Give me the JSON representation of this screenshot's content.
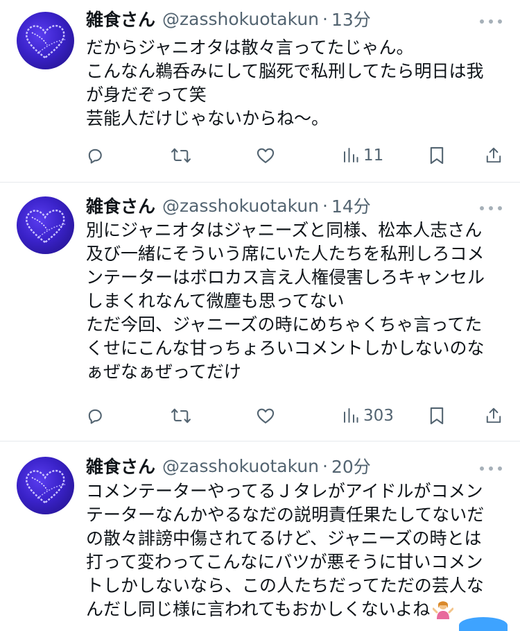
{
  "tweets": [
    {
      "name": "雑食さん",
      "handle": "@zasshokuotakun",
      "separator": "·",
      "time": "13分",
      "lines": [
        "だからジャニオタは散々言ってたじゃん。",
        "こんなん鵜呑みにして脳死で私刑してたら明日は我",
        "が身だぞって笑",
        "芸能人だけじゃないからね〜。"
      ],
      "views": "11"
    },
    {
      "name": "雑食さん",
      "handle": "@zasshokuotakun",
      "separator": "·",
      "time": "14分",
      "lines": [
        "別にジャニオタはジャニーズと同様、松本人志さん",
        "及び一緒にそういう席にいた人たちを私刑しろコメ",
        "ンテーターはボロカス言え人権侵害しろキャンセル",
        "しまくれなんて微塵も思ってない",
        "ただ今回、ジャニーズの時にめちゃくちゃ言ってた",
        "くせにこんな甘っちょろいコメントしかしないのな",
        "ぁぜなぁぜってだけ"
      ],
      "views": "303"
    },
    {
      "name": "雑食さん",
      "handle": "@zasshokuotakun",
      "separator": "·",
      "time": "20分",
      "lines": [
        "コメンテーターやってるＪタレがアイドルがコメン",
        "テーターなんかやるなだの説明責任果たしてないだ",
        "の散々誹謗中傷されてるけど、ジャニーズの時とは",
        "打って変わってこんなにバツが悪そうに甘いコメン",
        "トしかしないなら、この人たちだってただの芸人な",
        "んだし同じ様に言われてもおかしくないよね"
      ],
      "trailing_emoji": "person-shrugging-emoji"
    }
  ],
  "icons": {
    "reply": "reply-icon",
    "retweet": "retweet-icon",
    "like": "like-icon",
    "views": "views-icon",
    "bookmark": "bookmark-icon",
    "share": "share-icon",
    "more": "more-icon"
  },
  "colors": {
    "text": "#0f1419",
    "secondary": "#536471",
    "divider": "#e6e9ec",
    "avatar": "#3a22c9"
  }
}
